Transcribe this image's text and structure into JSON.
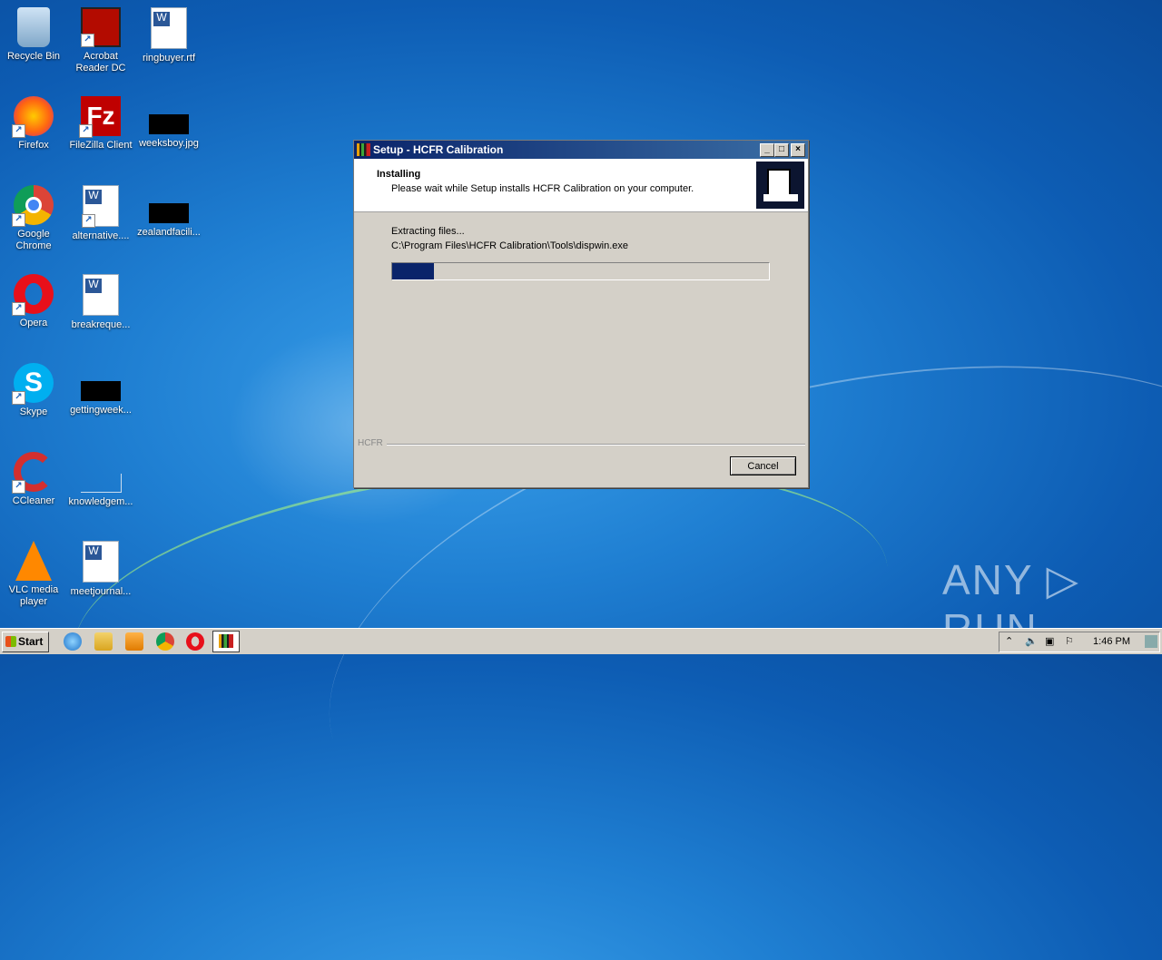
{
  "desktop_icons": [
    {
      "label": "Recycle Bin",
      "icon": "recycle-bin-icon"
    },
    {
      "label": "Acrobat Reader DC",
      "icon": "acrobat-icon"
    },
    {
      "label": "ringbuyer.rtf",
      "icon": "word-doc-icon"
    },
    {
      "label": "Firefox",
      "icon": "firefox-icon"
    },
    {
      "label": "FileZilla Client",
      "icon": "filezilla-icon"
    },
    {
      "label": "weeksboy.jpg",
      "icon": "image-file-icon"
    },
    {
      "label": "Google Chrome",
      "icon": "chrome-icon"
    },
    {
      "label": "alternative....",
      "icon": "word-doc-icon"
    },
    {
      "label": "zealandfacili...",
      "icon": "image-file-icon"
    },
    {
      "label": "Opera",
      "icon": "opera-icon"
    },
    {
      "label": "breakreque...",
      "icon": "word-doc-icon"
    },
    {
      "label": "Skype",
      "icon": "skype-icon"
    },
    {
      "label": "gettingweek...",
      "icon": "image-file-icon"
    },
    {
      "label": "CCleaner",
      "icon": "ccleaner-icon"
    },
    {
      "label": "knowledgem...",
      "icon": "file-icon"
    },
    {
      "label": "VLC media player",
      "icon": "vlc-icon"
    },
    {
      "label": "meetjournal...",
      "icon": "word-doc-icon"
    }
  ],
  "dialog": {
    "title": "Setup - HCFR Calibration",
    "heading": "Installing",
    "subheading": "Please wait while Setup installs HCFR Calibration on your computer.",
    "status": "Extracting files...",
    "path": "C:\\Program Files\\HCFR Calibration\\Tools\\dispwin.exe",
    "progress": 0.11,
    "brand": "HCFR",
    "cancel_label": "Cancel",
    "min_glyph": "_",
    "max_glyph": "□",
    "close_glyph": "×"
  },
  "taskbar": {
    "start_label": "Start",
    "clock": "1:46 PM",
    "pinned": [
      "internet-explorer-icon",
      "explorer-icon",
      "media-player-icon",
      "chrome-icon",
      "opera-icon",
      "hcfr-icon"
    ]
  },
  "watermark": "ANY ▷ RUN"
}
